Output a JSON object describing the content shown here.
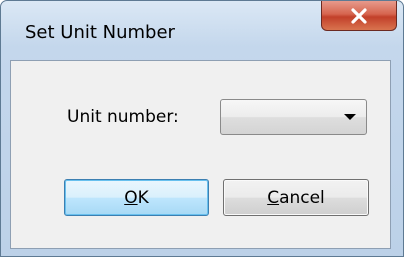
{
  "window": {
    "title": "Set Unit Number"
  },
  "title_bar": {
    "close_icon": "close-x-icon"
  },
  "form": {
    "unit_number_label": "Unit number:",
    "unit_number_value": ""
  },
  "buttons": {
    "ok": {
      "mnemonic": "O",
      "rest": "K"
    },
    "cancel": {
      "mnemonic": "C",
      "rest": "ancel"
    }
  },
  "colors": {
    "close_button": "#d6654f",
    "ok_button_border": "#3c7fb1",
    "frame": "#c4d7ec",
    "client_area": "#f0f0f0"
  }
}
